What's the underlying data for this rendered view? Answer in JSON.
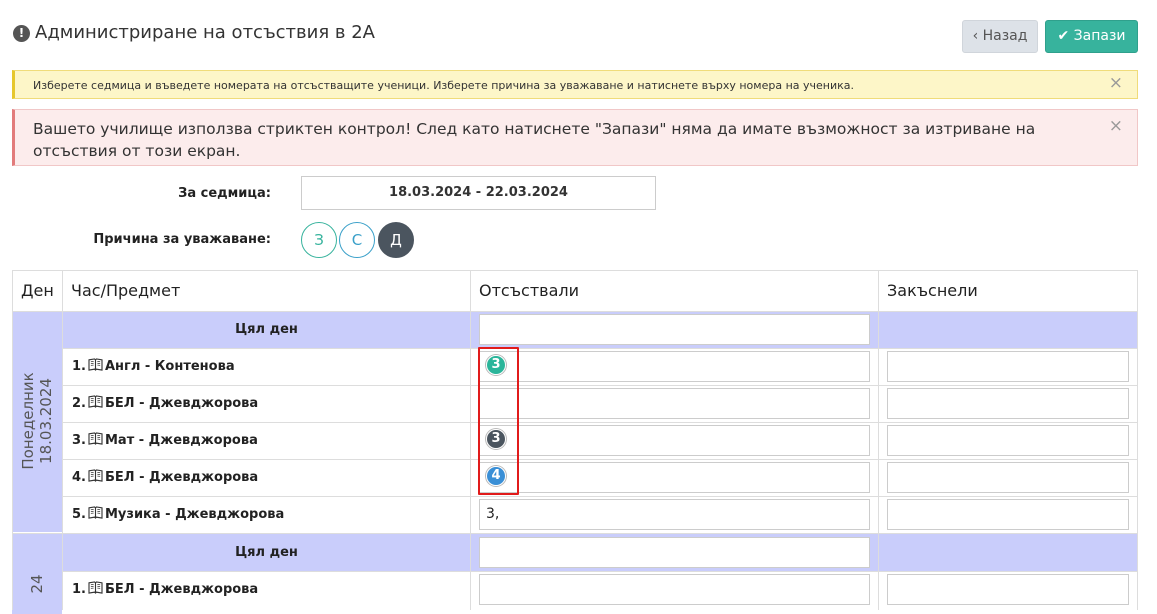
{
  "header": {
    "title": "Администриране на отсъствия в 2А",
    "title_icon": "exclamation-circle-icon",
    "back_label": "Назад",
    "save_label": "Запази"
  },
  "alerts": {
    "info": "Изберете седмица и въведете номерата на отсъстващите ученици. Изберете причина за уважаване и натиснете върху номера на ученика.",
    "strict": "Вашето училище използва стриктен контрол! След като натиснете \"Запази\" няма да имате възможност за изтриване на отсъствия от този екран.",
    "close_symbol": "×"
  },
  "form": {
    "week_label": "За седмица:",
    "week_value": "18.03.2024 - 22.03.2024",
    "reason_label": "Причина за уважаване:",
    "reasons": [
      "З",
      "С",
      "Д"
    ],
    "selected_reason": "Д"
  },
  "table": {
    "headers": [
      "Ден",
      "Час/Предмет",
      "Отсъствали",
      "Закъснели"
    ],
    "whole_day": "Цял ден",
    "day1": {
      "name": "Понеделник",
      "date": "18.03.2024",
      "lessons": [
        {
          "label": "1.",
          "subject": "Англ - Контенова",
          "tag": "3",
          "tag_color": "#2bb59a"
        },
        {
          "label": "2.",
          "subject": "БЕЛ - Джевджорова"
        },
        {
          "label": "3.",
          "subject": "Мат - Джевджорова",
          "tag": "3",
          "tag_color": "#4b555f"
        },
        {
          "label": "4.",
          "subject": "БЕЛ - Джевджорова",
          "tag": "4",
          "tag_color": "#3a8fd6"
        },
        {
          "label": "5.",
          "subject": "Музика - Джевджорова",
          "absent_value": "3,"
        }
      ]
    },
    "day2": {
      "date_fragment": "24",
      "lessons": [
        {
          "label": "1.",
          "subject": "БЕЛ - Джевджорова"
        }
      ]
    }
  }
}
